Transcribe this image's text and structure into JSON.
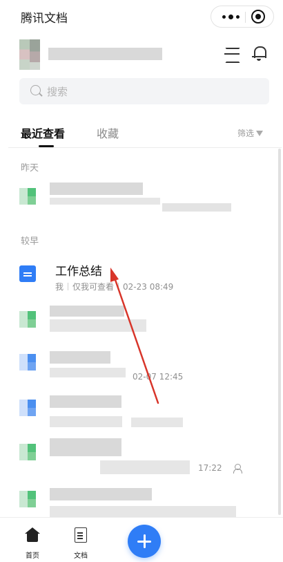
{
  "app": {
    "title": "腾讯文档"
  },
  "capsule": {
    "icons": [
      "more-icon",
      "target-icon"
    ]
  },
  "header": {
    "icons": [
      "scan-icon",
      "bell-icon"
    ]
  },
  "search": {
    "placeholder": "搜索"
  },
  "tabs": [
    {
      "label": "最近查看",
      "active": true
    },
    {
      "label": "收藏",
      "active": false
    }
  ],
  "filter": {
    "label": "筛选"
  },
  "sections": {
    "yesterday": "昨天",
    "earlier": "较早"
  },
  "docs": {
    "focus": {
      "title": "工作总结",
      "owner": "我",
      "permission": "仅我可查看",
      "time": "02-23 08:49"
    },
    "partial_times": [
      "02-07 12:45",
      "17:22"
    ]
  },
  "tabbar": {
    "home": "首页",
    "docs": "文档"
  },
  "colors": {
    "accent": "#2f7df6",
    "arrow": "#d8352a"
  }
}
